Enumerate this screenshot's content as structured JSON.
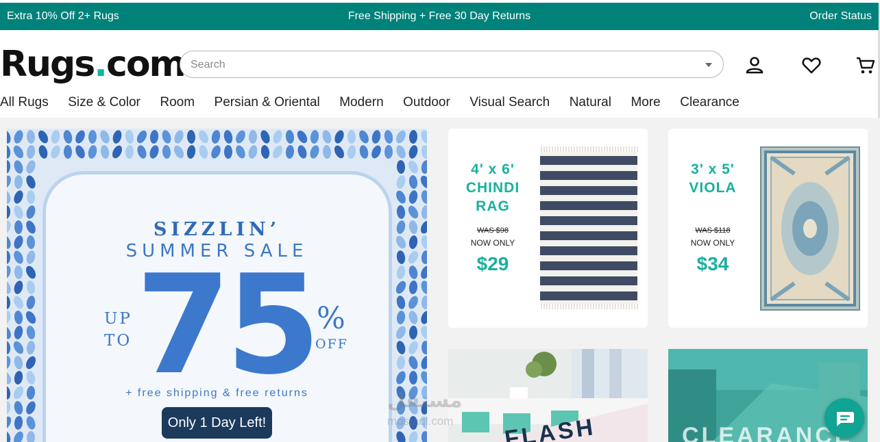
{
  "promo_bar": {
    "left": "Extra 10% Off 2+ Rugs",
    "center": "Free Shipping + Free 30 Day Returns",
    "right": "Order Status",
    "color": "#00827a"
  },
  "header": {
    "logo_main": "Rugs",
    "logo_dot": ".",
    "logo_tail": "com",
    "search_placeholder": "Search",
    "icons": [
      "account-icon",
      "heart-icon",
      "cart-icon"
    ]
  },
  "nav": {
    "items": [
      "All Rugs",
      "Size & Color",
      "Room",
      "Persian & Oriental",
      "Modern",
      "Outdoor",
      "Visual Search",
      "Natural",
      "More",
      "Clearance"
    ]
  },
  "hero": {
    "title_line1": "SIZZLIN’",
    "title_line2": "SUMMER SALE",
    "up": "UP",
    "to": "TO",
    "amount": "75",
    "percent": "%",
    "off": "OFF",
    "subtitle": "+ free shipping & free returns",
    "badge": "Only 1 Day Left!",
    "accent": "#3c78cc"
  },
  "deals": [
    {
      "size_line1": "4' x 6'",
      "size_line2": "CHINDI",
      "size_line3": "RAG",
      "was": "WAS $98",
      "now": "NOW ONLY",
      "price": "$29"
    },
    {
      "size_line1": "3' x 5'",
      "size_line2": "VIOLA",
      "size_line3": "",
      "was": "WAS $118",
      "now": "NOW ONLY",
      "price": "$34"
    }
  ],
  "tiles": {
    "flash_text": "FLASH",
    "clearance_text": "CLEARANCE"
  },
  "watermark": {
    "line1": "مستقل",
    "line2": "mostaql.com"
  },
  "colors": {
    "teal": "#19b0a0",
    "navy_badge": "#1b3a5c"
  }
}
